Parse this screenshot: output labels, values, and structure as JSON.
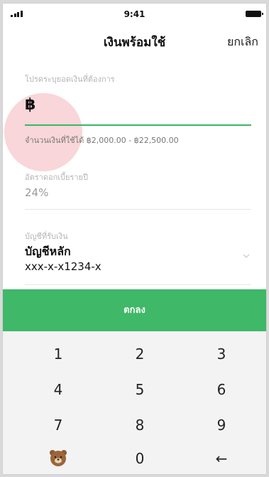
{
  "status_bar": {
    "time": "9:41"
  },
  "nav": {
    "title": "เงินพร้อมใช้",
    "cancel": "ยกเลิก"
  },
  "amount": {
    "label": "โปรดระบุยอดเงินที่ต้องการ",
    "currency_symbol": "฿",
    "value": "",
    "helper": "จำนวนเงินที่ใช้ได้ ฿2,000.00 - ฿22,500.00"
  },
  "rate": {
    "label": "อัตราดอกเบี้ยรายปี",
    "value": "24%"
  },
  "account": {
    "label": "บัญชีที่รับเงิน",
    "name": "บัญชีหลัก",
    "number": "xxx-x-x1234-x"
  },
  "confirm_button": "ตกลง",
  "keypad": {
    "keys": [
      "1",
      "2",
      "3",
      "4",
      "5",
      "6",
      "7",
      "8",
      "9",
      "0"
    ],
    "backspace": "←",
    "special_icon": "bear-icon"
  },
  "colors": {
    "accent": "#3fb868",
    "highlight": "rgba(232,108,118,0.28)",
    "muted_label": "#b5b5b5",
    "keypad_background": "#f3f3f3"
  }
}
